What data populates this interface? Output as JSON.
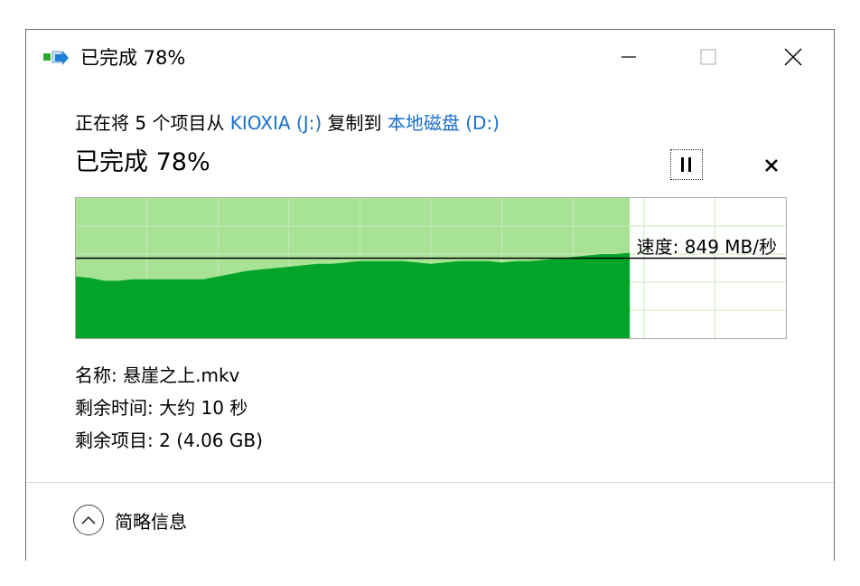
{
  "window": {
    "title": "已完成 78%",
    "icon": "copy-transfer-icon",
    "controls": {
      "minimize_icon": "minimize-icon",
      "maximize_icon": "maximize-icon",
      "close_icon": "close-icon"
    }
  },
  "operation": {
    "prefix": "正在将 5 个项目从 ",
    "source": "KIOXIA (J:)",
    "middle": " 复制到 ",
    "destination": "本地磁盘 (D:)",
    "status": "已完成 78%",
    "progress": 0.78,
    "pause_icon": "pause-icon",
    "cancel_icon": "cancel-icon"
  },
  "graph": {
    "speed_label": "速度: 849 MB/秒",
    "fill_color": "#a8e395",
    "speed_color": "#02a52a",
    "speed_profile": [
      0.44,
      0.43,
      0.41,
      0.41,
      0.42,
      0.42,
      0.42,
      0.42,
      0.42,
      0.42,
      0.44,
      0.46,
      0.48,
      0.49,
      0.5,
      0.51,
      0.52,
      0.53,
      0.53,
      0.54,
      0.55,
      0.55,
      0.55,
      0.55,
      0.54,
      0.53,
      0.54,
      0.55,
      0.55,
      0.55,
      0.54,
      0.55,
      0.55,
      0.56,
      0.57,
      0.58,
      0.59,
      0.6,
      0.6,
      0.61
    ],
    "current_speed_level": 0.59
  },
  "details": {
    "name_label": "名称: ",
    "name_value": "悬崖之上.mkv",
    "time_label": "剩余时间: ",
    "time_value": "大约 10 秒",
    "items_label": "剩余项目: ",
    "items_value": "2 (4.06 GB)"
  },
  "footer": {
    "toggle_label": "简略信息",
    "toggle_icon": "chevron-up-icon"
  }
}
